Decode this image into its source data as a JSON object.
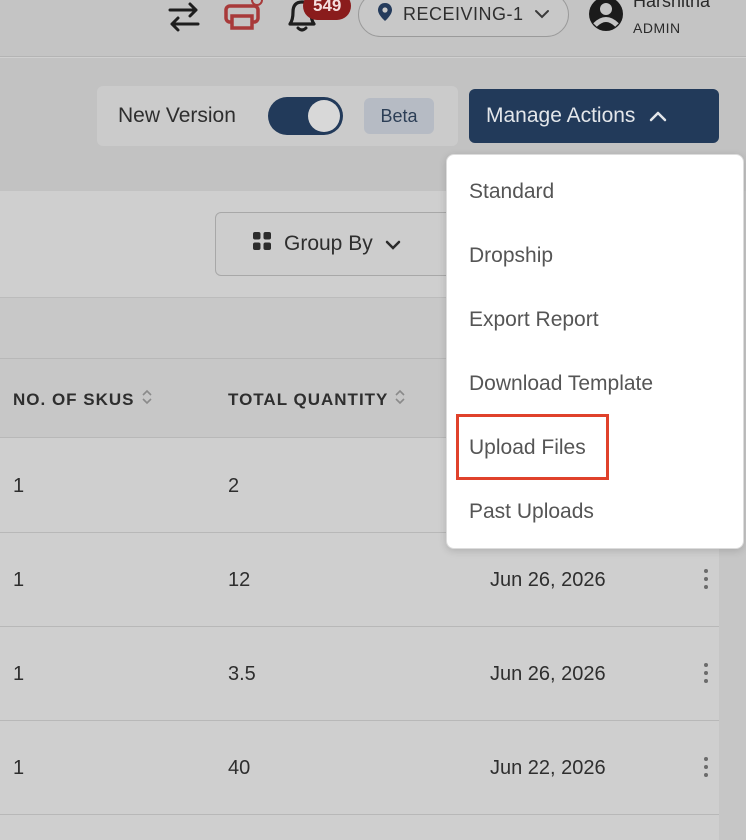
{
  "header": {
    "swap_icon": "swap-arrows-icon",
    "print_icon": "printer-icon",
    "bell_icon": "bell-icon",
    "notification_count": "549",
    "location": "RECEIVING-1",
    "user_name": "Harshitha",
    "user_role": "ADMIN"
  },
  "toolbar": {
    "version_label": "New Version",
    "beta_label": "Beta",
    "toggle_on": true,
    "manage_label": "Manage Actions",
    "group_by_label": "Group By"
  },
  "table": {
    "columns": [
      "NO. OF SKUS",
      "TOTAL QUANTITY"
    ],
    "rows": [
      {
        "skus": "1",
        "quantity": "2",
        "date": ""
      },
      {
        "skus": "1",
        "quantity": "12",
        "date": "Jun 26, 2026"
      },
      {
        "skus": "1",
        "quantity": "3.5",
        "date": "Jun 26, 2026"
      },
      {
        "skus": "1",
        "quantity": "40",
        "date": "Jun 22, 2026"
      }
    ]
  },
  "menu": {
    "items": [
      "Standard",
      "Dropship",
      "Export Report",
      "Download Template",
      "Upload Files",
      "Past Uploads"
    ],
    "highlighted": "Upload Files"
  },
  "colors": {
    "primary": "#223a5a",
    "highlight": "#e0412b",
    "badge": "#8a1c1c"
  }
}
